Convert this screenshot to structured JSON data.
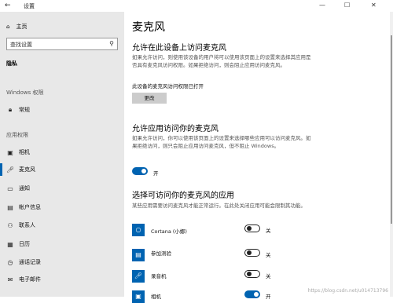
{
  "window": {
    "back": "←",
    "title": "设置",
    "minimize": "—",
    "maximize": "☐",
    "close": "✕"
  },
  "sidebar": {
    "home": "主页",
    "search_placeholder": "查找设置",
    "category": "隐私",
    "section_windows": "Windows 权限",
    "windows_items": [
      {
        "label": "常规",
        "icon": "lock-icon"
      }
    ],
    "section_app": "应用权限",
    "app_items": [
      {
        "label": "相机",
        "icon": "camera-icon"
      },
      {
        "label": "麦克风",
        "icon": "microphone-icon"
      },
      {
        "label": "通知",
        "icon": "notification-icon"
      },
      {
        "label": "帐户信息",
        "icon": "account-icon"
      },
      {
        "label": "联系人",
        "icon": "contacts-icon"
      },
      {
        "label": "日历",
        "icon": "calendar-icon"
      },
      {
        "label": "通话记录",
        "icon": "call-history-icon"
      },
      {
        "label": "电子邮件",
        "icon": "email-icon"
      }
    ]
  },
  "main": {
    "title": "麦克风",
    "s1_heading": "允许在此设备上访问麦克风",
    "s1_desc": "如果允许访问，则使用该设备的用户将可以使用该页面上的设置来选择其应用是否具有麦克风访问权限。如果拒绝访问，则会阻止应用访问麦克风。",
    "s1_status": "此设备的麦克风访问权限已打开",
    "s1_button": "更改",
    "s2_heading": "允许应用访问你的麦克风",
    "s2_desc": "如果允许访问，你可以使用该页面上的设置来选择哪些应用可以访问麦克风。如果拒绝访问，则只会阻止应用访问麦克风，但不阻止 Windows。",
    "s2_toggle": {
      "state": "on",
      "label": "开"
    },
    "s3_heading": "选择可访问你的麦克风的应用",
    "s3_desc": "某些应用需要访问麦克风才能正常运行。在此处关闭应用可能会限制其功能。",
    "apps": [
      {
        "name": "Cortana (小娜)",
        "state": "off",
        "label": "关",
        "icon": "cortana-icon"
      },
      {
        "name": "参加测验",
        "state": "off",
        "label": "关",
        "icon": "quiz-icon"
      },
      {
        "name": "录音机",
        "state": "off",
        "label": "关",
        "icon": "recorder-icon"
      },
      {
        "name": "相机",
        "state": "on",
        "label": "开",
        "icon": "camera-app-icon"
      }
    ]
  },
  "watermark": "https://blog.csdn.net/u014713796",
  "colors": {
    "accent": "#0063b1",
    "sidebar_bg": "#e8e8e8"
  }
}
